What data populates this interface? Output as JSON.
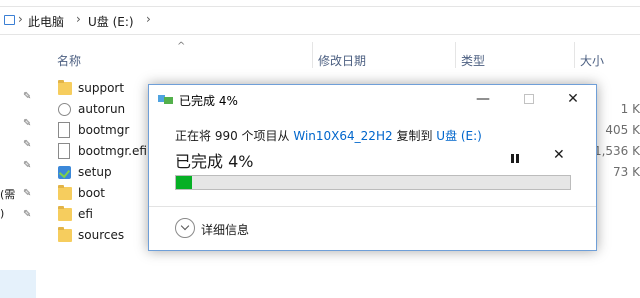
{
  "address": {
    "crumbs": [
      "此电脑",
      "U盘 (E:)"
    ]
  },
  "columns": {
    "name": "名称",
    "modified": "修改日期",
    "type": "类型",
    "size": "大小"
  },
  "nav_fragments": [
    "(需",
    ")"
  ],
  "files": [
    {
      "name": "support",
      "icon": "folder-icon",
      "size": ""
    },
    {
      "name": "autorun",
      "icon": "settings-file-icon",
      "size": "1 K"
    },
    {
      "name": "bootmgr",
      "icon": "file-icon",
      "size": "405 K"
    },
    {
      "name": "bootmgr.efi",
      "icon": "file-icon",
      "size": "1,536 K"
    },
    {
      "name": "setup",
      "icon": "setup-icon",
      "size": "73 K"
    },
    {
      "name": "boot",
      "icon": "folder-icon",
      "size": ""
    },
    {
      "name": "efi",
      "icon": "folder-icon",
      "size": ""
    },
    {
      "name": "sources",
      "icon": "folder-icon",
      "size": ""
    }
  ],
  "dialog": {
    "title": "已完成 4%",
    "copy_prefix": "正在将 990 个项目从",
    "source": "Win10X64_22H2",
    "copy_mid": "复制到",
    "destination": "U盘 (E:)",
    "percent_text": "已完成 4%",
    "progress": 0.04,
    "details_label": "详细信息",
    "progress_color": "#06b025"
  }
}
